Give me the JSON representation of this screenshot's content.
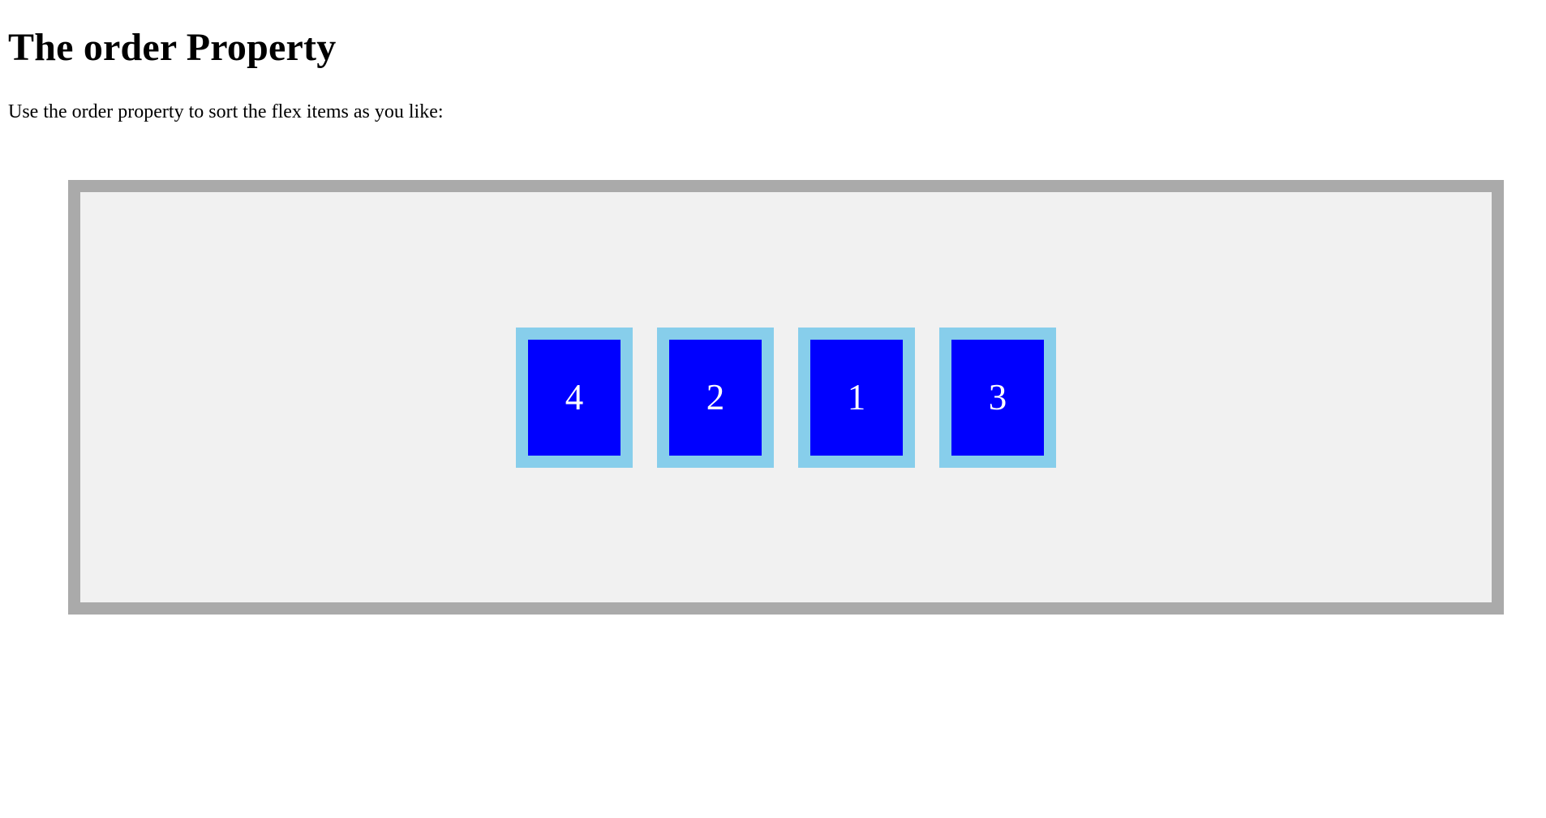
{
  "page": {
    "title": "The order Property",
    "intro": "Use the order property to sort the flex items as you like:"
  },
  "flex_container": {
    "items": [
      {
        "label": "4"
      },
      {
        "label": "2"
      },
      {
        "label": "1"
      },
      {
        "label": "3"
      }
    ]
  },
  "colors": {
    "container_border": "#aaaaaa",
    "container_background": "#f1f1f1",
    "item_border": "#87ceeb",
    "item_background": "#0000ff",
    "item_text": "#ffffff"
  }
}
